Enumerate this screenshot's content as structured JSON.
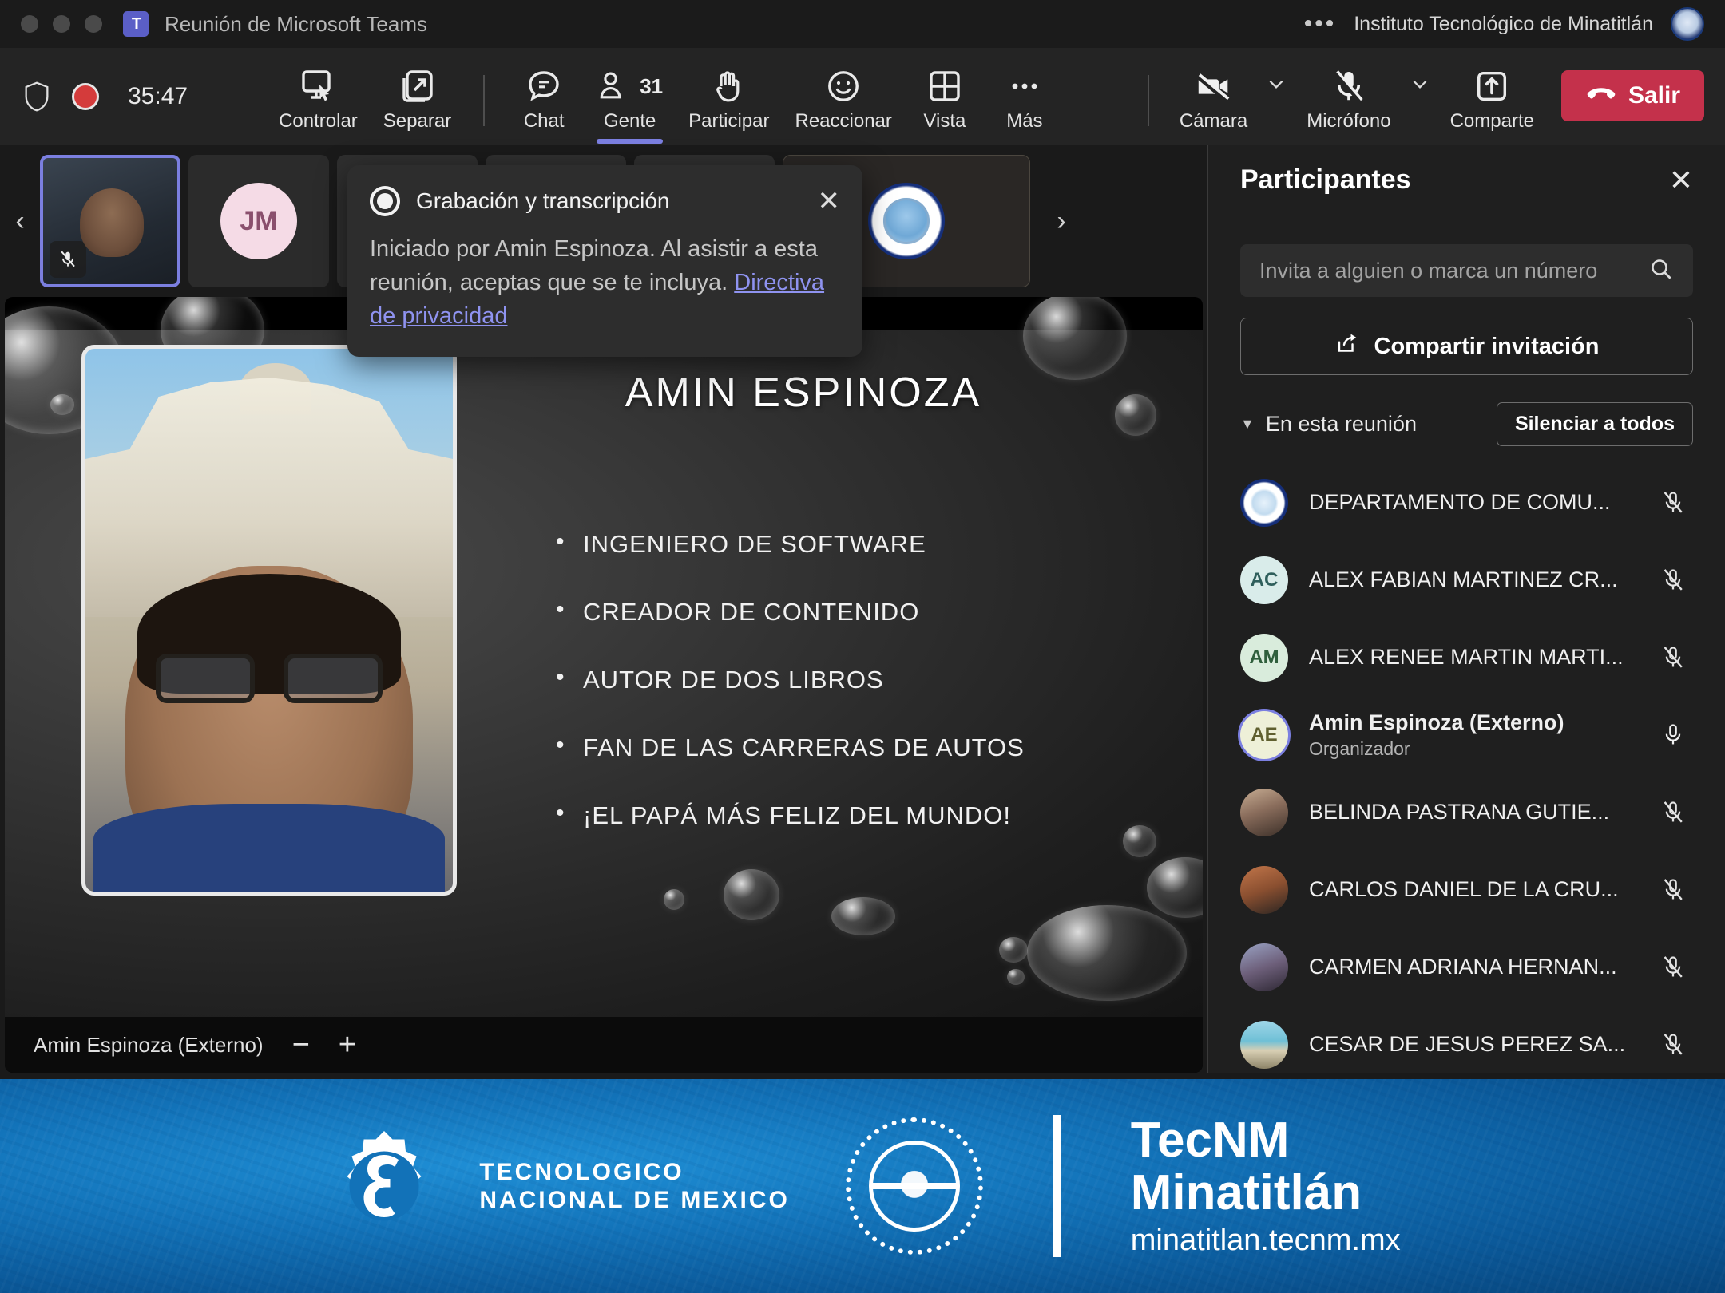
{
  "titlebar": {
    "window_title": "Reunión de Microsoft Teams",
    "org_name": "Instituto Tecnológico de Minatitlán",
    "more_icon": "ellipsis-icon",
    "app_icon": "teams-logo-icon"
  },
  "toolbar": {
    "shield_icon": "shield-icon",
    "recording_icon": "recording-dot-icon",
    "timer": "35:47",
    "items": [
      {
        "label": "Controlar",
        "icon": "screen-control-icon",
        "active": false
      },
      {
        "label": "Separar",
        "icon": "pop-out-icon",
        "active": false
      },
      {
        "label": "Chat",
        "icon": "chat-bubble-icon",
        "active": false
      },
      {
        "label": "Gente",
        "icon": "people-icon",
        "active": true,
        "count": "31"
      },
      {
        "label": "Participar",
        "icon": "raise-hand-icon",
        "active": false
      },
      {
        "label": "Reaccionar",
        "icon": "smiley-icon",
        "active": false
      },
      {
        "label": "Vista",
        "icon": "grid-view-icon",
        "active": false
      },
      {
        "label": "Más",
        "icon": "ellipsis-icon",
        "active": false
      }
    ],
    "right_items": [
      {
        "label": "Cámara",
        "icon": "camera-off-icon",
        "has_chevron": true
      },
      {
        "label": "Micrófono",
        "icon": "mic-off-icon",
        "has_chevron": true
      },
      {
        "label": "Comparte",
        "icon": "share-screen-icon",
        "has_chevron": false
      }
    ],
    "leave_label": "Salir",
    "leave_icon": "hangup-icon",
    "leave_color": "#c4314b",
    "accent_color": "#7b7fe0"
  },
  "filmstrip": {
    "prev_icon": "chevron-left-icon",
    "next_icon": "chevron-right-icon",
    "tiles": [
      {
        "type": "video",
        "name": "self-video-tile",
        "selected": true,
        "muted": true
      },
      {
        "type": "avatar",
        "initials": "JM",
        "muted": false
      },
      {
        "type": "placeholder",
        "muted": false
      },
      {
        "type": "placeholder",
        "muted": false
      },
      {
        "type": "placeholder",
        "muted": false
      },
      {
        "type": "logo",
        "name": "tecnm-logo-tile",
        "muted": true
      }
    ]
  },
  "toast": {
    "title": "Grabación y transcripción",
    "body_before": "Iniciado por Amin Espinoza. Al asistir a esta reunión, aceptas que se te incluya. ",
    "link": "Directiva de privacidad",
    "close_icon": "close-icon",
    "record_icon": "recording-dot-icon"
  },
  "stage": {
    "presenter_name": "Amin Espinoza (Externo)",
    "zoom_out_label": "−",
    "zoom_in_label": "+",
    "slide": {
      "title": "AMIN ESPINOZA",
      "bullets": [
        "INGENIERO DE SOFTWARE",
        "CREADOR DE CONTENIDO",
        "AUTOR DE DOS LIBROS",
        "FAN DE LAS CARRERAS DE AUTOS",
        "¡EL PAPÁ MÁS FELIZ DEL MUNDO!"
      ]
    }
  },
  "panel": {
    "title": "Participantes",
    "close_icon": "close-icon",
    "search_placeholder": "Invita a alguien o marca un número",
    "search_value": "",
    "search_icon": "search-icon",
    "share_invite_label": "Compartir invitación",
    "share_invite_icon": "share-icon",
    "section_label": "En esta reunión",
    "caret_icon": "caret-down-icon",
    "mute_all_label": "Silenciar a todos",
    "participants": [
      {
        "name": "DEPARTAMENTO DE COMU...",
        "avatar_type": "seal",
        "initials": "",
        "muted": true,
        "role": "",
        "highlighted": false
      },
      {
        "name": "ALEX FABIAN MARTINEZ CR...",
        "avatar_type": "initials",
        "initials": "AC",
        "avatar_color": "#d9ecea",
        "text_color": "#2f5f5c",
        "muted": true,
        "role": "",
        "highlighted": false
      },
      {
        "name": "ALEX RENEE MARTIN MARTI...",
        "avatar_type": "initials",
        "initials": "AM",
        "avatar_color": "#d9ecdc",
        "text_color": "#2f5f3c",
        "muted": true,
        "role": "",
        "highlighted": false
      },
      {
        "name": "Amin Espinoza (Externo)",
        "avatar_type": "initials",
        "initials": "AE",
        "avatar_color": "#eef0d8",
        "text_color": "#5f5f2f",
        "muted": false,
        "role": "Organizador",
        "highlighted": true
      },
      {
        "name": "BELINDA PASTRANA GUTIE...",
        "avatar_type": "photo",
        "photo_tone": "#8a6d5c",
        "muted": true,
        "role": "",
        "highlighted": false
      },
      {
        "name": "CARLOS DANIEL DE LA CRU...",
        "avatar_type": "photo",
        "photo_tone": "#a05f3c",
        "muted": true,
        "role": "",
        "highlighted": false
      },
      {
        "name": "CARMEN ADRIANA HERNAN...",
        "avatar_type": "photo",
        "photo_tone": "#6d5f7a",
        "muted": true,
        "role": "",
        "highlighted": false
      },
      {
        "name": "CESAR DE JESUS PEREZ SA...",
        "avatar_type": "photo",
        "photo_tone": "#4f8fb5",
        "muted": true,
        "role": "",
        "highlighted": false
      }
    ]
  },
  "footer": {
    "tnm_line1": "TECNOLOGICO",
    "tnm_line2": "NACIONAL DE MEXICO",
    "brand_line1": "TecNM",
    "brand_line2": "Minatitlán",
    "brand_url": "minatitlan.tecnm.mx",
    "gear_icon": "tecnm-gear-icon",
    "seal_icon": "itm-seal-icon",
    "bg_color": "#1272b8"
  }
}
